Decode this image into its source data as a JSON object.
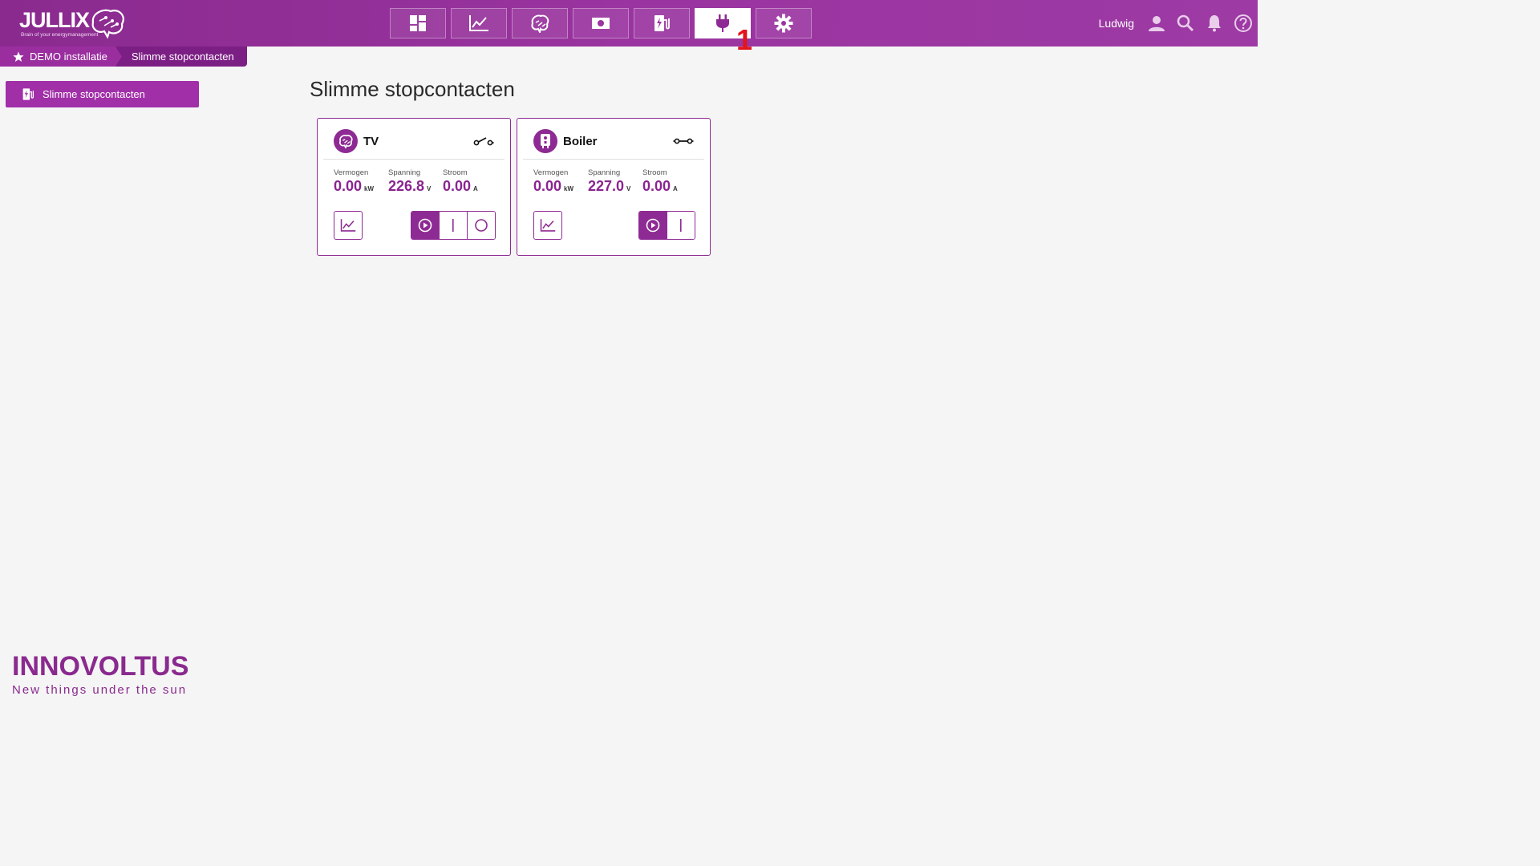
{
  "header": {
    "logo_text": "JULLIX",
    "logo_tagline": "Brain of your energymanagement",
    "nav": [
      {
        "name": "dashboard",
        "icon": "dashboard-icon",
        "active": false
      },
      {
        "name": "graphs",
        "icon": "line-chart-icon",
        "active": false
      },
      {
        "name": "brain",
        "icon": "brain-icon",
        "active": false
      },
      {
        "name": "costs",
        "icon": "money-icon",
        "active": false
      },
      {
        "name": "chargers",
        "icon": "ev-charger-icon",
        "active": false
      },
      {
        "name": "plugs",
        "icon": "plug-icon",
        "active": true
      },
      {
        "name": "settings",
        "icon": "gear-icon",
        "active": false
      }
    ],
    "badge": "1",
    "username": "Ludwig"
  },
  "breadcrumb": {
    "home": "DEMO installatie",
    "current": "Slimme stopcontacten"
  },
  "sidebar": {
    "items": [
      {
        "label": "Slimme stopcontacten",
        "icon": "ev-charger-icon"
      }
    ]
  },
  "main": {
    "title": "Slimme stopcontacten",
    "cards": [
      {
        "name": "TV",
        "icon": "brain-icon",
        "switch_icon": "switch-open-icon",
        "metrics": [
          {
            "label": "Vermogen",
            "value": "0.00",
            "unit": "kW"
          },
          {
            "label": "Spanning",
            "value": "226.8",
            "unit": "V"
          },
          {
            "label": "Stroom",
            "value": "0.00",
            "unit": "A"
          }
        ],
        "modes": [
          "auto",
          "on",
          "off"
        ],
        "active_mode": "auto"
      },
      {
        "name": "Boiler",
        "icon": "boiler-icon",
        "switch_icon": "switch-closed-icon",
        "metrics": [
          {
            "label": "Vermogen",
            "value": "0.00",
            "unit": "kW"
          },
          {
            "label": "Spanning",
            "value": "227.0",
            "unit": "V"
          },
          {
            "label": "Stroom",
            "value": "0.00",
            "unit": "A"
          }
        ],
        "modes": [
          "auto",
          "on"
        ],
        "active_mode": "auto"
      }
    ]
  },
  "footer": {
    "brand": "INNOVOLTUS",
    "tagline": "New things under the sun"
  },
  "colors": {
    "primary": "#8e2a93",
    "header": "#9a34a0",
    "badge": "#e3141b",
    "background": "#f5f5f5"
  }
}
